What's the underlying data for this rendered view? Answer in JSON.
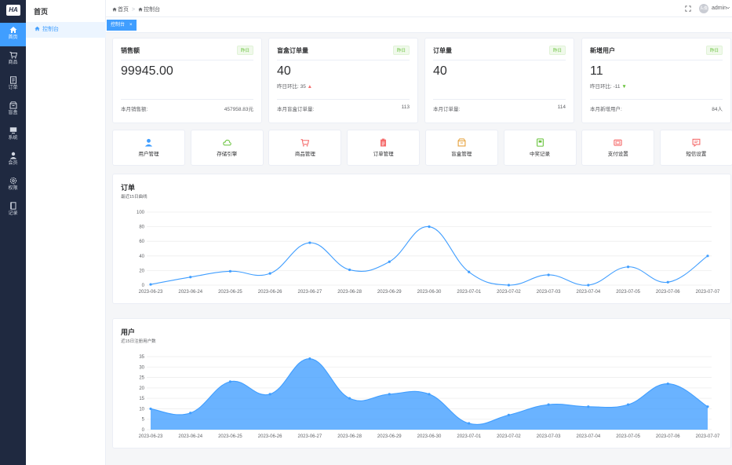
{
  "logo": "HA",
  "rail": [
    {
      "label": "首页",
      "icon": "home-icon",
      "active": true
    },
    {
      "label": "商品",
      "icon": "cart-icon"
    },
    {
      "label": "订单",
      "icon": "order-icon"
    },
    {
      "label": "盲盒",
      "icon": "box-icon"
    },
    {
      "label": "系统",
      "icon": "monitor-icon"
    },
    {
      "label": "会员",
      "icon": "user-icon"
    },
    {
      "label": "权限",
      "icon": "setting-icon"
    },
    {
      "label": "记录",
      "icon": "record-icon"
    }
  ],
  "menu": {
    "title": "首页",
    "item": "控制台"
  },
  "breadcrumb": [
    "首页",
    "控制台"
  ],
  "user": {
    "name": "admin",
    "avatar_text": "头像"
  },
  "tag": {
    "label": "控制台",
    "close": "×"
  },
  "stats": [
    {
      "title": "销售额",
      "badge": "昨日",
      "value": "99945.00",
      "sub_label": "",
      "sub_value": "",
      "trend": "",
      "foot_label": "本月销售额:",
      "foot_value": "457958.83元"
    },
    {
      "title": "盲盒订单量",
      "badge": "昨日",
      "value": "40",
      "sub_label": "昨日环比:",
      "sub_value": "35",
      "trend": "up",
      "foot_label": "本月盲盒订单量:",
      "foot_value": "113"
    },
    {
      "title": "订单量",
      "badge": "昨日",
      "value": "40",
      "sub_label": "",
      "sub_value": "",
      "trend": "",
      "foot_label": "本月订单量:",
      "foot_value": "114"
    },
    {
      "title": "新增用户",
      "badge": "昨日",
      "value": "11",
      "sub_label": "昨日环比:",
      "sub_value": "-11",
      "trend": "down",
      "foot_label": "本月新增用户:",
      "foot_value": "84人"
    }
  ],
  "shortcuts": [
    {
      "label": "用户管理",
      "icon": "user-icon",
      "color": "#409eff"
    },
    {
      "label": "存储引擎",
      "icon": "cloud-icon",
      "color": "#67c23a"
    },
    {
      "label": "商品管理",
      "icon": "cart-icon",
      "color": "#f56c6c"
    },
    {
      "label": "订单管理",
      "icon": "clipboard-icon",
      "color": "#f56c6c"
    },
    {
      "label": "盲盒管理",
      "icon": "box-icon",
      "color": "#e6a23c"
    },
    {
      "label": "中奖记录",
      "icon": "book-icon",
      "color": "#67c23a"
    },
    {
      "label": "支付设置",
      "icon": "money-icon",
      "color": "#f56c6c"
    },
    {
      "label": "短信设置",
      "icon": "message-icon",
      "color": "#f56c6c"
    }
  ],
  "chart_data": [
    {
      "type": "line",
      "title": "订单",
      "subtitle": "最近15日曲线",
      "x": [
        "2023-06-23",
        "2023-06-24",
        "2023-06-25",
        "2023-06-26",
        "2023-06-27",
        "2023-06-28",
        "2023-06-29",
        "2023-06-30",
        "2023-07-01",
        "2023-07-02",
        "2023-07-03",
        "2023-07-04",
        "2023-07-05",
        "2023-07-06",
        "2023-07-07"
      ],
      "series": [
        {
          "values": [
            1,
            11,
            19,
            16,
            58,
            21,
            32,
            80,
            18,
            0,
            14,
            0,
            25,
            4,
            40
          ]
        }
      ],
      "ylim": [
        0,
        100
      ],
      "yticks": [
        0,
        20,
        40,
        60,
        80,
        100
      ],
      "color": "#409eff",
      "grid": true
    },
    {
      "type": "area",
      "title": "用户",
      "subtitle": "近15日注册用户数",
      "x": [
        "2023-06-23",
        "2023-06-24",
        "2023-06-25",
        "2023-06-26",
        "2023-06-27",
        "2023-06-28",
        "2023-06-29",
        "2023-06-30",
        "2023-07-01",
        "2023-07-02",
        "2023-07-03",
        "2023-07-04",
        "2023-07-05",
        "2023-07-06",
        "2023-07-07"
      ],
      "series": [
        {
          "values": [
            10,
            8,
            23,
            17,
            34,
            15,
            17,
            17,
            3,
            7,
            12,
            11,
            12,
            22,
            11
          ]
        }
      ],
      "ylim": [
        0,
        35
      ],
      "yticks": [
        0,
        5,
        10,
        15,
        20,
        25,
        30,
        35
      ],
      "color": "#409eff",
      "grid": true
    }
  ]
}
